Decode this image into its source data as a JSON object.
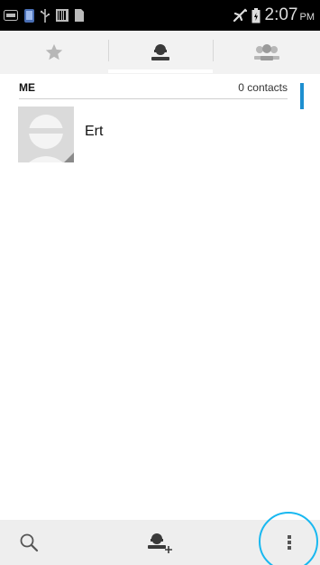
{
  "status_bar": {
    "time": "2:07",
    "ampm": "PM",
    "left_icons": [
      "notification-count-icon",
      "phone-icon",
      "usb-icon",
      "barcode-icon",
      "sim-icon"
    ],
    "right_icons": [
      "airplane-mode-icon",
      "battery-icon"
    ]
  },
  "tabs": [
    {
      "name": "favorites",
      "icon": "star-icon",
      "selected": false
    },
    {
      "name": "contacts",
      "icon": "person-icon",
      "selected": true
    },
    {
      "name": "groups",
      "icon": "group-icon",
      "selected": false
    }
  ],
  "list": {
    "section_title": "ME",
    "count_label": "0 contacts",
    "contacts": [
      {
        "name": "Ert"
      }
    ]
  },
  "bottom_bar": {
    "search_icon": "search-icon",
    "add_contact_icon": "add-contact-icon",
    "menu_icon": "overflow-menu-icon"
  },
  "colors": {
    "accent": "#1e8fd0",
    "highlight_ring": "#19b8f0",
    "status_bar": "#000000",
    "tab_bar": "#f2f2f2",
    "bottom_bar": "#eeeeee"
  }
}
